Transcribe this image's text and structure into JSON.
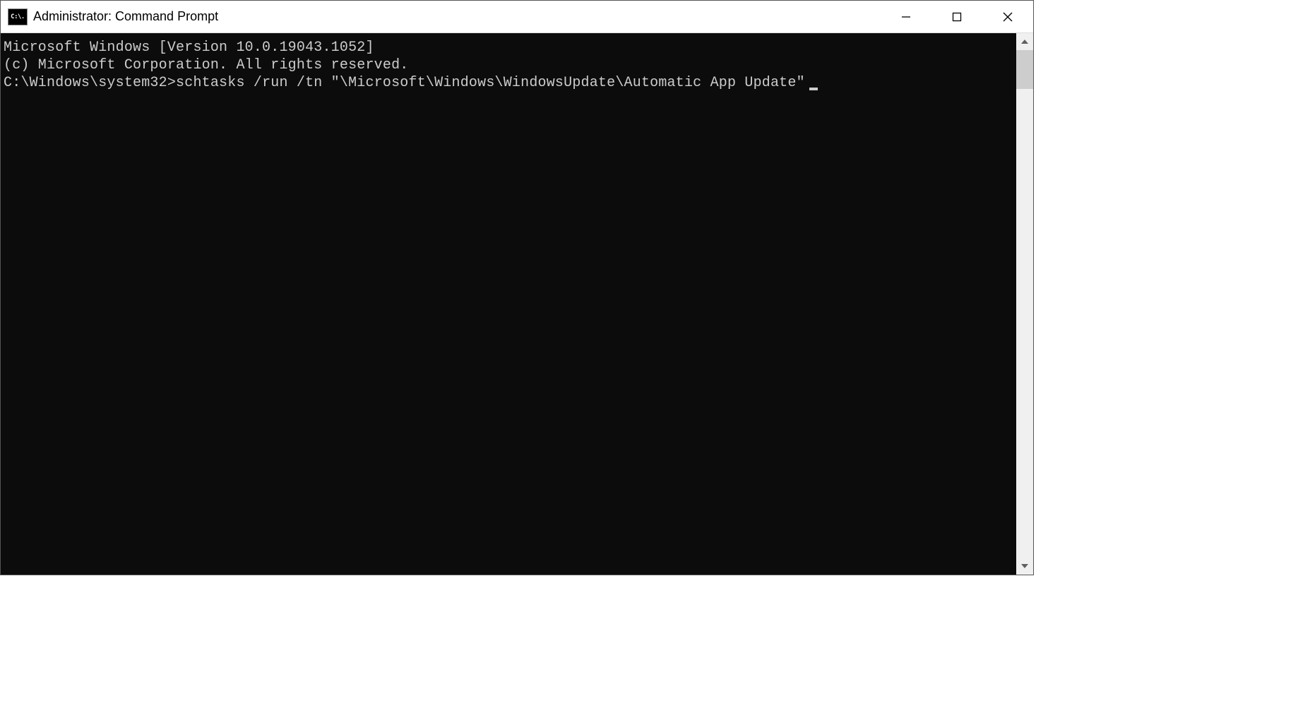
{
  "titlebar": {
    "icon_text": "C:\\.",
    "title": "Administrator: Command Prompt"
  },
  "terminal": {
    "line1": "Microsoft Windows [Version 10.0.19043.1052]",
    "line2": "(c) Microsoft Corporation. All rights reserved.",
    "blank": "",
    "prompt": "C:\\Windows\\system32>",
    "command": "schtasks /run /tn \"\\Microsoft\\Windows\\WindowsUpdate\\Automatic App Update\""
  }
}
